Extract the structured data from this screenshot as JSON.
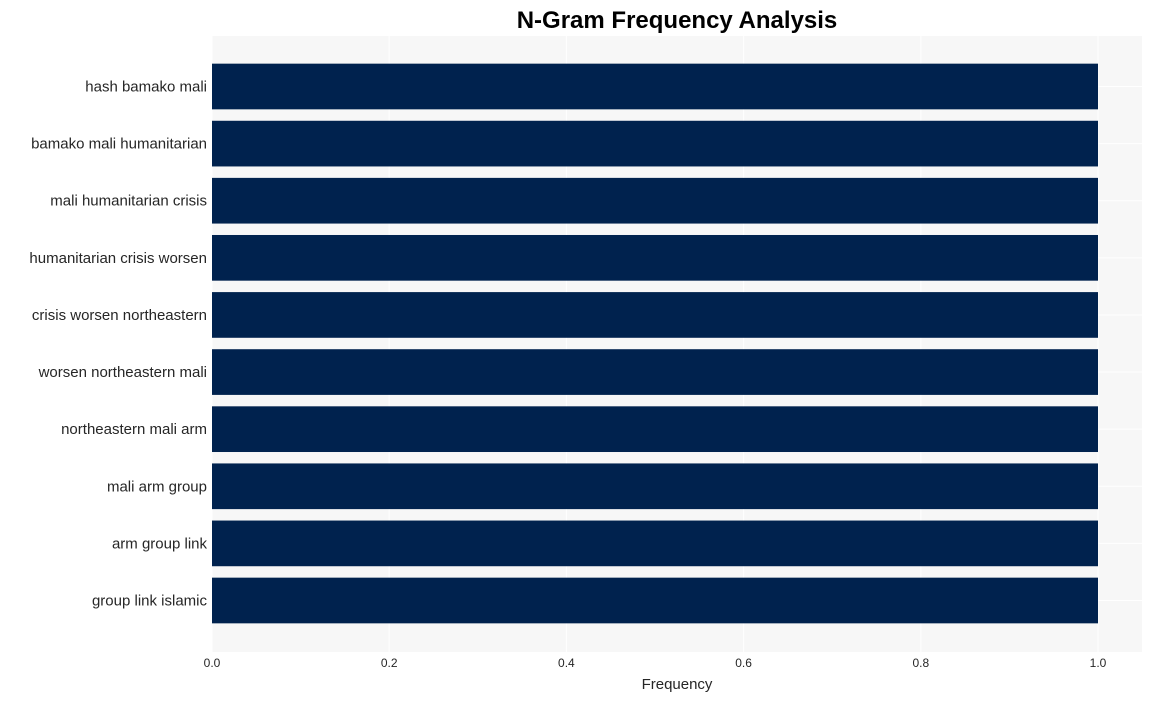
{
  "chart_data": {
    "type": "bar",
    "orientation": "horizontal",
    "title": "N-Gram Frequency Analysis",
    "xlabel": "Frequency",
    "ylabel": "",
    "categories": [
      "hash bamako mali",
      "bamako mali humanitarian",
      "mali humanitarian crisis",
      "humanitarian crisis worsen",
      "crisis worsen northeastern",
      "worsen northeastern mali",
      "northeastern mali arm",
      "mali arm group",
      "arm group link",
      "group link islamic"
    ],
    "values": [
      1,
      1,
      1,
      1,
      1,
      1,
      1,
      1,
      1,
      1
    ],
    "xlim": [
      0,
      1.05
    ],
    "xticks": [
      0.0,
      0.2,
      0.4,
      0.6,
      0.8,
      1.0
    ],
    "xtick_labels": [
      "0.0",
      "0.2",
      "0.4",
      "0.6",
      "0.8",
      "1.0"
    ],
    "grid": true,
    "legend": "none",
    "colors": {
      "bar": "#00224e",
      "plot_background": "#f7f7f7",
      "grid": "#ffffff"
    }
  }
}
